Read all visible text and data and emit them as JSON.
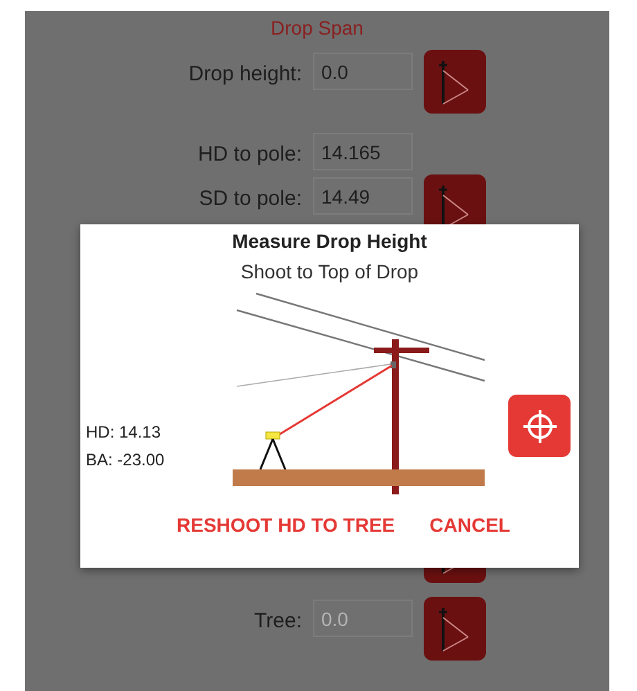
{
  "screen": {
    "title": "Drop Span",
    "rows": [
      {
        "kind": "field",
        "label": "Drop height:",
        "value": "0.0",
        "button": true
      },
      {
        "kind": "field",
        "label": "HD to pole:",
        "value": "14.165",
        "button": false
      },
      {
        "kind": "field",
        "label": "SD to pole:",
        "value": "14.49",
        "button": true
      },
      {
        "kind": "hidden",
        "button": true
      },
      {
        "kind": "field",
        "label": "Tree:",
        "placeholder": "0.0",
        "button": true
      }
    ]
  },
  "dialog": {
    "title": "Measure Drop Height",
    "instruction": "Shoot to Top of Drop",
    "readings": [
      "HD: 14.13",
      "BA: -23.00"
    ],
    "actions": [
      "RESHOOT HD TO TREE",
      "CANCEL"
    ]
  }
}
